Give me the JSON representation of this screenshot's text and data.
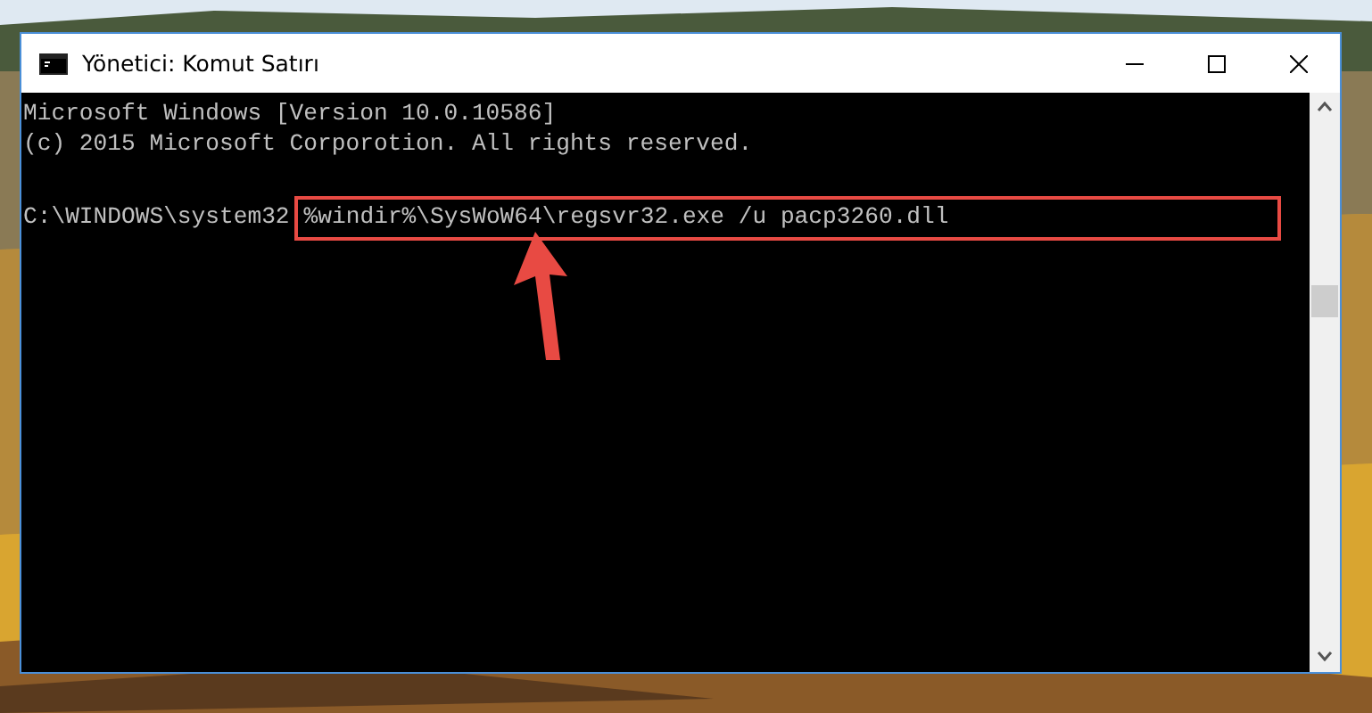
{
  "window": {
    "title": "Yönetici: Komut Satırı"
  },
  "console": {
    "lines": [
      {
        "text": "Microsoft Windows [Version 10.0.10586]"
      },
      {
        "text": "(c) 2015 Microsoft Corporotion. All rights reserved."
      }
    ],
    "prompt": "C:\\WINDOWS\\system32",
    "command": "%windir%\\SysWoW64\\regsvr32.exe /u pacp3260.dll"
  }
}
